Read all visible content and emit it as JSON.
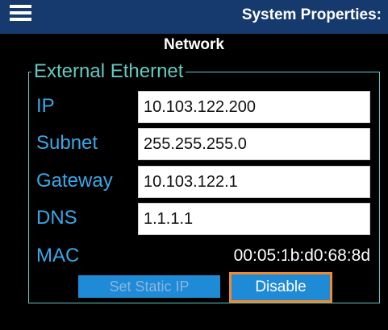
{
  "header": {
    "title": "System Properties:",
    "subtitle": "Network"
  },
  "ethernet": {
    "legend": "External Ethernet",
    "ip_label": "IP",
    "ip_value": "10.103.122.200",
    "subnet_label": "Subnet",
    "subnet_value": "255.255.255.0",
    "gateway_label": "Gateway",
    "gateway_value": "10.103.122.1",
    "dns_label": "DNS",
    "dns_value": "1.1.1.1",
    "mac_label": "MAC",
    "mac_value": "00:05:1b:d0:68:8d"
  },
  "buttons": {
    "set_static_ip": "Set Static IP",
    "disable": "Disable"
  },
  "icons": {
    "menu": "menu-icon"
  },
  "colors": {
    "header_bg": "#173a6e",
    "group_border": "#63c7c0",
    "label_blue": "#39a8e8",
    "button_bg": "#1f8ad6",
    "focus_outline": "#f08a2c"
  }
}
